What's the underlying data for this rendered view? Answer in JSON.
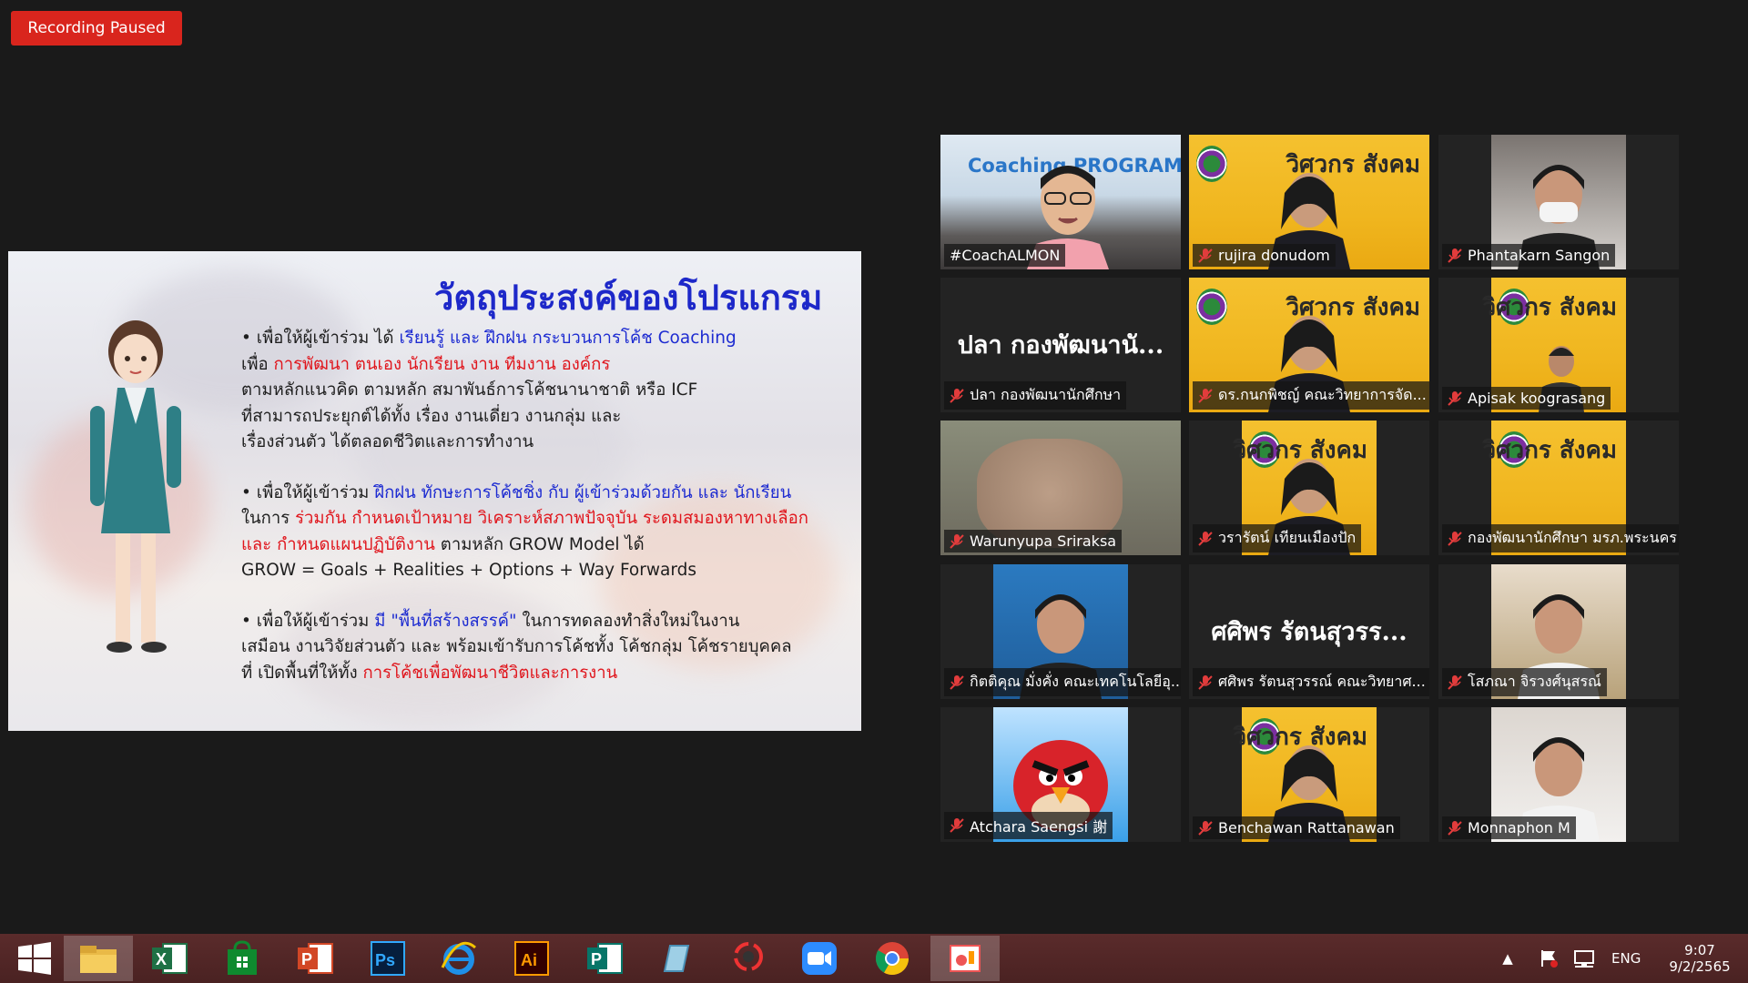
{
  "recording": {
    "label": "Recording Paused",
    "color": "#d9251d"
  },
  "slide": {
    "title": "วัตถุประสงค์ของโปรแกรม",
    "p1": {
      "l1a": "• เพื่อให้ผู้เข้าร่วม ได้ ",
      "l1b": "เรียนรู้ และ ฝึกฝน กระบวนการโค้ช Coaching",
      "l2a": "เพื่อ ",
      "l2b": "การพัฒนา ตนเอง นักเรียน งาน ทีมงาน องค์กร",
      "l3": "ตามหลักแนวคิด ตามหลัก สมาพันธ์การโค้ชนานาชาติ หรือ ICF",
      "l4": "ที่สามารถประยุกต์ได้ทั้ง เรื่อง งานเดี่ยว งานกลุ่ม และ",
      "l5": "เรื่องส่วนตัว ได้ตลอดชีวิตและการทำงาน"
    },
    "p2": {
      "l1a": "• เพื่อให้ผู้เข้าร่วม ",
      "l1b": "ฝึกฝน ทักษะการโค้ชชิ่ง กับ ผู้เข้าร่วมด้วยกัน และ นักเรียน",
      "l2a": "ในการ ",
      "l2b": "ร่วมกัน กำหนดเป้าหมาย วิเคราะห์สภาพปัจจุบัน ระดมสมองหาทางเลือก",
      "l3a": "และ กำหนดแผนปฏิบัติงาน",
      "l3b": " ตามหลัก GROW Model ได้",
      "l4": "GROW = Goals + Realities + Options + Way Forwards"
    },
    "p3": {
      "l1a": "• เพื่อให้ผู้เข้าร่วม ",
      "l1b": "มี \"พื้นที่สร้างสรรค์\"",
      "l1c": " ในการทดลองทำสิ่งใหม่ในงาน",
      "l2": "เสมือน งานวิจัยส่วนตัว และ พร้อมเข้ารับการโค้ชทั้ง โค้ชกลุ่ม โค้ชรายบุคคล",
      "l3a": "ที่ เปิดพื้นที่ให้ทั้ง ",
      "l3b": "การโค้ชเพื่อพัฒนาชีวิตและการงาน"
    }
  },
  "participants": [
    {
      "name": "#CoachALMON",
      "muted": false,
      "active": true,
      "video_text": "Coaching PROGRAM for ...r"
    },
    {
      "name": "rujira donudom",
      "muted": true,
      "poster": "วิศวกร สังคม"
    },
    {
      "name": "Phantakarn Sangon",
      "muted": true
    },
    {
      "name": "ปลา กองพัฒนานักศึกษา",
      "muted": true,
      "big": "ปลา กองพัฒนานั..."
    },
    {
      "name": "ดร.กนกพิชญ์ คณะวิทยาการจัด...",
      "muted": true,
      "poster": "วิศวกร สังคม"
    },
    {
      "name": "Apisak koograsang",
      "muted": true,
      "poster": "วิศวกร สังคม"
    },
    {
      "name": "Warunyupa Sriraksa",
      "muted": true
    },
    {
      "name": "วรารัตน์ เทียนเมืองปัก",
      "muted": true,
      "poster": "วิศวกร สังคม"
    },
    {
      "name": "กองพัฒนานักศึกษา มรภ.พระนคร",
      "muted": true,
      "poster": "วิศวกร สังคม"
    },
    {
      "name": "กิตติคุณ มั่งคั่ง คณะเทคโนโลยีอุ...",
      "muted": true
    },
    {
      "name": "ศศิพร รัตนสุวรรณ์ คณะวิทยาศ...",
      "muted": true,
      "big": "ศศิพร รัตนสุวรร..."
    },
    {
      "name": "โสภณา จิรวงศ์นุสรณ์",
      "muted": true
    },
    {
      "name": "Atchara Saengsi 謝",
      "muted": true
    },
    {
      "name": "Benchawan Rattanawan",
      "muted": true,
      "poster": "วิศวกร สังคม"
    },
    {
      "name": "Monnaphon M",
      "muted": true
    }
  ],
  "taskbar": {
    "apps": [
      "start-icon",
      "file-explorer-icon",
      "excel-icon",
      "store-icon",
      "powerpoint-icon",
      "photoshop-icon",
      "internet-explorer-icon",
      "illustrator-icon",
      "publisher-icon",
      "notepad-icon",
      "photoscape-icon",
      "zoom-icon",
      "chrome-icon",
      "snipping-tool-icon"
    ],
    "lang": "ENG",
    "time": "9:07",
    "date": "9/2/2565"
  }
}
